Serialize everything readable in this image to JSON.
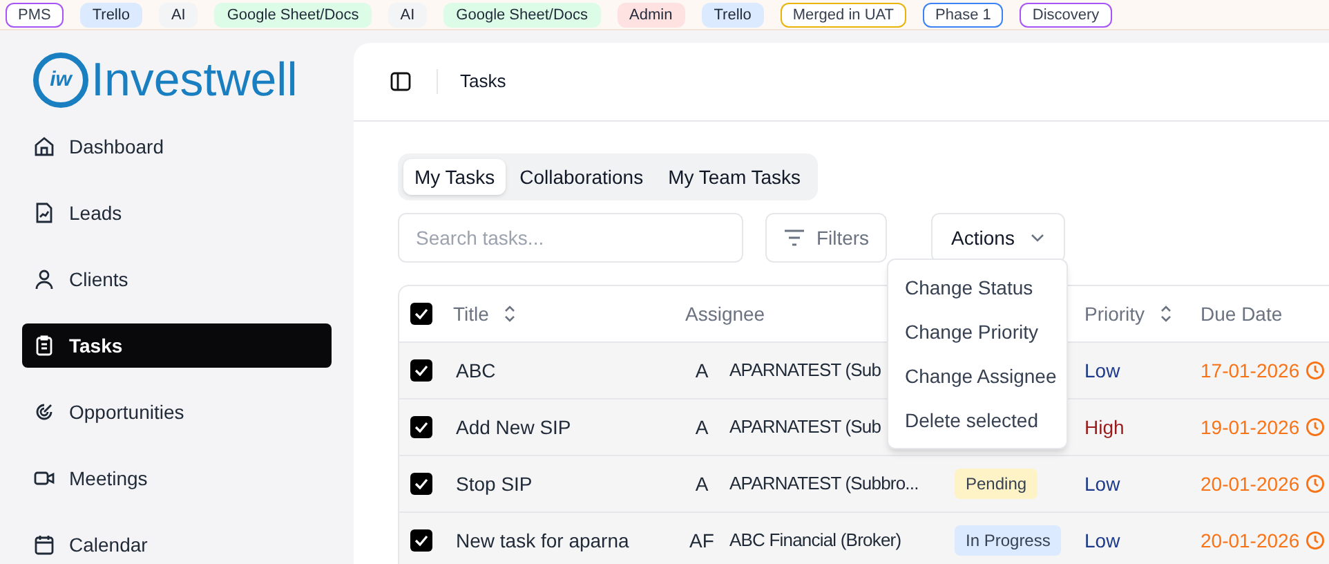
{
  "tags": [
    {
      "label": "PMS",
      "color": "#a855f7",
      "kind": "outline"
    },
    {
      "label": "Trello",
      "color": "#dbeafe",
      "kind": "soft"
    },
    {
      "label": "AI",
      "color": "#f3f4f6",
      "kind": "soft"
    },
    {
      "label": "Google Sheet/Docs",
      "color": "#dcfce7",
      "kind": "soft"
    },
    {
      "label": "AI",
      "color": "#f3f4f6",
      "kind": "soft"
    },
    {
      "label": "Google Sheet/Docs",
      "color": "#dcfce7",
      "kind": "soft"
    },
    {
      "label": "Admin",
      "color": "#fee2e2",
      "kind": "soft"
    },
    {
      "label": "Trello",
      "color": "#dbeafe",
      "kind": "soft"
    },
    {
      "label": "Merged in UAT",
      "color": "#eab308",
      "kind": "outline"
    },
    {
      "label": "Phase 1",
      "color": "#3b82f6",
      "kind": "outline"
    },
    {
      "label": "Discovery",
      "color": "#a855f7",
      "kind": "outline"
    }
  ],
  "logo": {
    "mark": "iw",
    "name": "Investwell"
  },
  "sidebar": {
    "items": [
      {
        "label": "Dashboard",
        "selected": false
      },
      {
        "label": "Leads",
        "selected": false
      },
      {
        "label": "Clients",
        "selected": false
      },
      {
        "label": "Tasks",
        "selected": true
      },
      {
        "label": "Opportunities",
        "selected": false
      },
      {
        "label": "Meetings",
        "selected": false
      },
      {
        "label": "Calendar",
        "selected": false
      }
    ]
  },
  "header": {
    "title": "Tasks"
  },
  "tabs": [
    {
      "label": "My Tasks",
      "selected": true
    },
    {
      "label": "Collaborations",
      "selected": false
    },
    {
      "label": "My Team Tasks",
      "selected": false
    }
  ],
  "search": {
    "placeholder": "Search tasks..."
  },
  "filters_button": "Filters",
  "actions_button": "Actions",
  "actions_menu": [
    "Change Status",
    "Change Priority",
    "Change Assignee",
    "Delete selected"
  ],
  "table": {
    "all_checked": true,
    "columns": [
      "Title",
      "Assignee",
      "Priority",
      "Due Date"
    ],
    "rows": [
      {
        "checked": true,
        "title": "ABC",
        "initials": "A",
        "assignee": "APARNATEST (Sub",
        "priority": {
          "label": "Low",
          "color": "#1e3a8a"
        },
        "due": "17-01-2026"
      },
      {
        "checked": true,
        "title": "Add New SIP",
        "initials": "A",
        "assignee": "APARNATEST (Sub",
        "priority": {
          "label": "High",
          "color": "#991b1b"
        },
        "due": "19-01-2026"
      },
      {
        "checked": true,
        "title": "Stop SIP",
        "initials": "A",
        "assignee": "APARNATEST (Subbro...",
        "status": {
          "label": "Pending",
          "color": "#fef3c7"
        },
        "priority": {
          "label": "Low",
          "color": "#1e3a8a"
        },
        "due": "20-01-2026"
      },
      {
        "checked": true,
        "title": "New task for aparna",
        "initials": "AF",
        "assignee": "ABC Financial (Broker)",
        "status": {
          "label": "In Progress",
          "color": "#dbeafe"
        },
        "priority": {
          "label": "Low",
          "color": "#1e3a8a"
        },
        "due": "20-01-2026"
      }
    ]
  }
}
